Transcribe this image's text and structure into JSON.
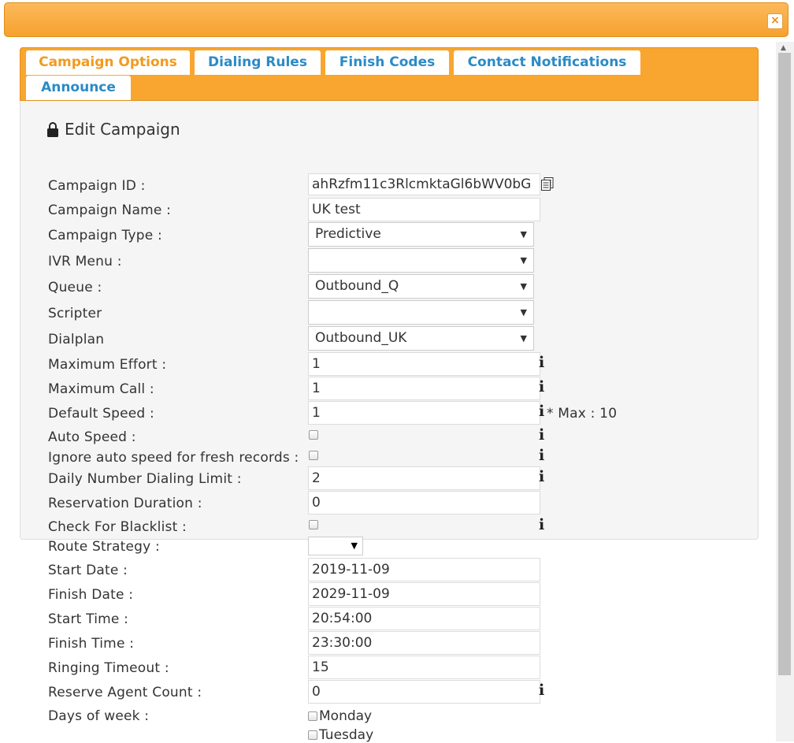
{
  "dialog": {
    "close_label": "×"
  },
  "tabs": [
    {
      "label": "Campaign Options"
    },
    {
      "label": "Dialing Rules"
    },
    {
      "label": "Finish Codes"
    },
    {
      "label": "Contact Notifications"
    },
    {
      "label": "Announce"
    }
  ],
  "form": {
    "title": "Edit Campaign",
    "campaign_id": {
      "label": "Campaign ID :",
      "value": "ahRzfm11c3RlcmktaGl6bWV0bG"
    },
    "campaign_name": {
      "label": "Campaign Name :",
      "value": "UK test"
    },
    "campaign_type": {
      "label": "Campaign Type :",
      "value": "Predictive"
    },
    "ivr_menu": {
      "label": "IVR Menu :",
      "value": ""
    },
    "queue": {
      "label": "Queue :",
      "value": "Outbound_Q"
    },
    "scripter": {
      "label": "Scripter",
      "value": ""
    },
    "dialplan": {
      "label": "Dialplan",
      "value": "Outbound_UK"
    },
    "maximum_effort": {
      "label": "Maximum Effort :",
      "value": "1"
    },
    "maximum_call": {
      "label": "Maximum Call :",
      "value": "1"
    },
    "default_speed": {
      "label": "Default Speed :",
      "value": "1",
      "note": "* Max : 10"
    },
    "auto_speed": {
      "label": "Auto Speed :",
      "checked": false
    },
    "ignore_auto_speed": {
      "label": "Ignore auto speed for fresh records :",
      "checked": false
    },
    "daily_limit": {
      "label": "Daily Number Dialing Limit :",
      "value": "2"
    },
    "reservation_duration": {
      "label": "Reservation Duration :",
      "value": "0"
    },
    "check_blacklist": {
      "label": "Check For Blacklist :",
      "checked": false
    },
    "route_strategy": {
      "label": "Route Strategy :",
      "value": ""
    },
    "start_date": {
      "label": "Start Date :",
      "value": "2019-11-09"
    },
    "finish_date": {
      "label": "Finish Date :",
      "value": "2029-11-09"
    },
    "start_time": {
      "label": "Start Time :",
      "value": "20:54:00"
    },
    "finish_time": {
      "label": "Finish Time :",
      "value": "23:30:00"
    },
    "ringing_timeout": {
      "label": "Ringing Timeout :",
      "value": "15"
    },
    "reserve_agent_count": {
      "label": "Reserve Agent Count :",
      "value": "0"
    },
    "days_of_week": {
      "label": "Days of week :",
      "days": [
        "Monday",
        "Tuesday"
      ]
    }
  },
  "icons": {
    "info": "i",
    "dropdown": "▼"
  },
  "colors": {
    "accent": "#f8a630",
    "tab_text": "#2a8bc7",
    "active_tab_text": "#f39a1d"
  }
}
